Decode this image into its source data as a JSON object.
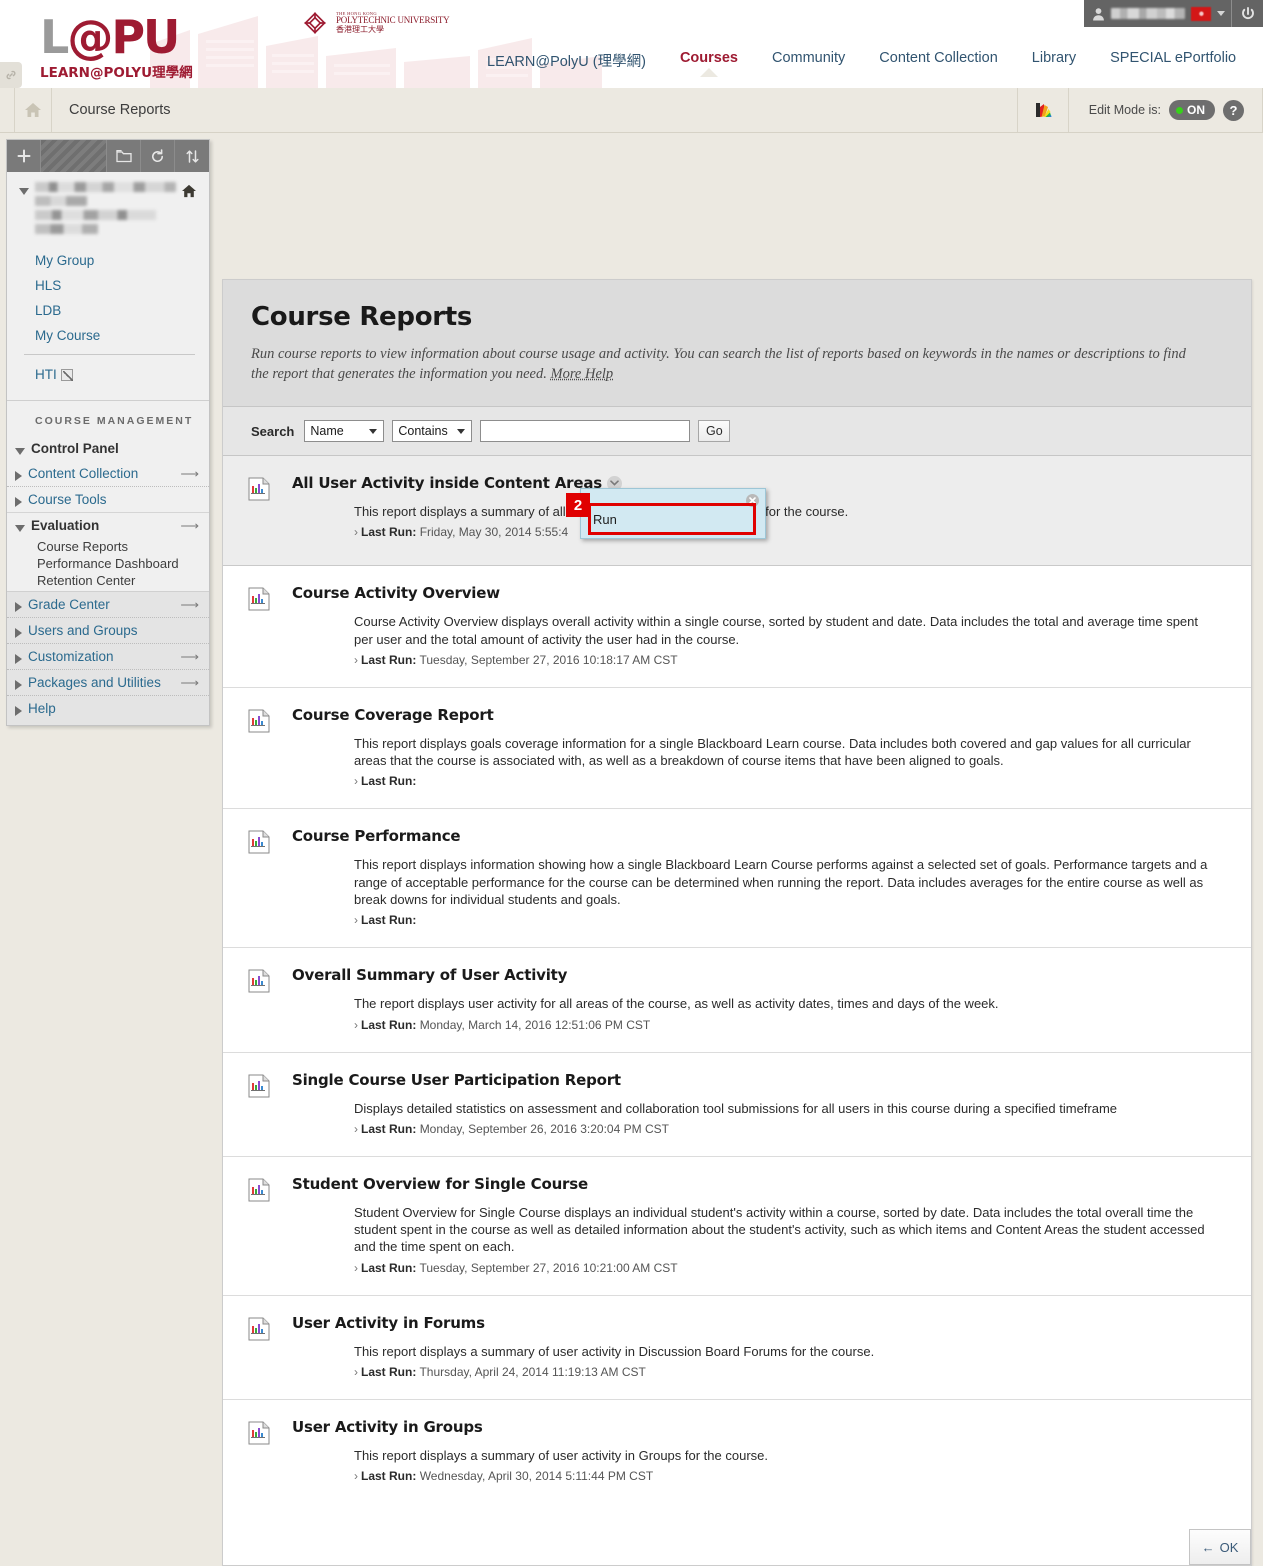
{
  "brand": {
    "logo_l": "L",
    "logo_at": "@",
    "logo_pu": "PU",
    "logo_sub": "LEARN@POLYU理學網",
    "university_line1": "THE HONG KONG",
    "university_line2": "POLYTECHNIC UNIVERSITY",
    "university_line3": "香港理工大學"
  },
  "global_nav": [
    {
      "label": "LEARN@PolyU (理學網)",
      "active": false
    },
    {
      "label": "Courses",
      "active": true
    },
    {
      "label": "Community",
      "active": false
    },
    {
      "label": "Content Collection",
      "active": false
    },
    {
      "label": "Library",
      "active": false
    },
    {
      "label": "SPECIAL ePortfolio",
      "active": false
    }
  ],
  "user_menu": {
    "name_masked": "",
    "power_title": "Logout"
  },
  "breadcrumb": {
    "title": "Course Reports",
    "edit_mode_label": "Edit Mode is:",
    "edit_mode_value": "ON",
    "help_label": "?"
  },
  "sidebar": {
    "toolbar_icons": [
      "plus-icon",
      "hatched-area",
      "folder-icon",
      "refresh-icon",
      "sort-icon"
    ],
    "course_links": [
      {
        "label": "My Group"
      },
      {
        "label": "HLS"
      },
      {
        "label": "LDB"
      },
      {
        "label": "My Course"
      }
    ],
    "hti_label": "HTI",
    "course_management_title": "COURSE MANAGEMENT",
    "control_panel_label": "Control Panel",
    "panel_items": [
      {
        "label": "Content Collection",
        "arrow": "⟶",
        "expanded": false
      },
      {
        "label": "Course Tools",
        "arrow": "",
        "expanded": false
      },
      {
        "label": "Evaluation",
        "arrow": "⟶",
        "expanded": true
      },
      {
        "label": "Grade Center",
        "arrow": "⟶",
        "expanded": false
      },
      {
        "label": "Users and Groups",
        "arrow": "",
        "expanded": false
      },
      {
        "label": "Customization",
        "arrow": "⟶",
        "expanded": false
      },
      {
        "label": "Packages and Utilities",
        "arrow": "⟶",
        "expanded": false
      },
      {
        "label": "Help",
        "arrow": "",
        "expanded": false
      }
    ],
    "evaluation_sub": [
      {
        "label": "Course Reports"
      },
      {
        "label": "Performance Dashboard"
      },
      {
        "label": "Retention Center"
      }
    ]
  },
  "main": {
    "title": "Course Reports",
    "description": "Run course reports to view information about course usage and activity. You can search the list of reports based on keywords in the names or descriptions to find the report that generates the information you need.",
    "more_help": "More Help",
    "search": {
      "label": "Search",
      "field_selected": "Name",
      "condition_selected": "Contains",
      "input_value": "",
      "input_placeholder": "",
      "go_label": "Go"
    },
    "reports": [
      {
        "title": "All User Activity inside Content Areas",
        "description": "This report displays a summary of all user activity inside Content Areas for the course.",
        "last_run_label": "Last Run:",
        "last_run_value": "Friday, May 30, 2014 5:55:4"
      },
      {
        "title": "Course Activity Overview",
        "description": "Course Activity Overview displays overall activity within a single course, sorted by student and date. Data includes the total and average time spent per user and the total amount of activity the user had in the course.",
        "last_run_label": "Last Run:",
        "last_run_value": "Tuesday, September 27, 2016 10:18:17 AM CST"
      },
      {
        "title": "Course Coverage Report",
        "description": "This report displays goals coverage information for a single Blackboard Learn course. Data includes both covered and gap values for all curricular areas that the course is associated with, as well as a breakdown of course items that have been aligned to goals.",
        "last_run_label": "Last Run:",
        "last_run_value": ""
      },
      {
        "title": "Course Performance",
        "description": "This report displays information showing how a single Blackboard Learn Course performs against a selected set of goals. Performance targets and a range of acceptable performance for the course can be determined when running the report. Data includes averages for the entire course as well as break downs for individual students and goals.",
        "last_run_label": "Last Run:",
        "last_run_value": ""
      },
      {
        "title": "Overall Summary of User Activity",
        "description": "The report displays user activity for all areas of the course, as well as activity dates, times and days of the week.",
        "last_run_label": "Last Run:",
        "last_run_value": "Monday, March 14, 2016 12:51:06 PM CST"
      },
      {
        "title": "Single Course User Participation Report",
        "description": "Displays detailed statistics on assessment and collaboration tool submissions for all users in this course during a specified timeframe",
        "last_run_label": "Last Run:",
        "last_run_value": "Monday, September 26, 2016 3:20:04 PM CST"
      },
      {
        "title": "Student Overview for Single Course",
        "description": "Student Overview for Single Course displays an individual student's activity within a course, sorted by date. Data includes the total overall time the student spent in the course as well as detailed information about the student's activity, such as which items and Content Areas the student accessed and the time spent on each.",
        "last_run_label": "Last Run:",
        "last_run_value": "Tuesday, September 27, 2016 10:21:00 AM CST"
      },
      {
        "title": "User Activity in Forums",
        "description": "This report displays a summary of user activity in Discussion Board Forums for the course.",
        "last_run_label": "Last Run:",
        "last_run_value": "Thursday, April 24, 2014 11:19:13 AM CST"
      },
      {
        "title": "User Activity in Groups",
        "description": "This report displays a summary of user activity in Groups for the course.",
        "last_run_label": "Last Run:",
        "last_run_value": "Wednesday, April 30, 2014 5:11:44 PM CST"
      }
    ],
    "ok_button": "OK",
    "ok_arrow": "←"
  },
  "popup": {
    "items": [
      {
        "label": "Run"
      }
    ],
    "step_number": "2",
    "close_label": "×"
  },
  "colors": {
    "brand_red": "#9e1b32",
    "link_blue": "#2b6a8e",
    "highlight_red": "#e00000",
    "popup_bg": "#d2e9f2",
    "page_bg": "#ece9e1"
  }
}
